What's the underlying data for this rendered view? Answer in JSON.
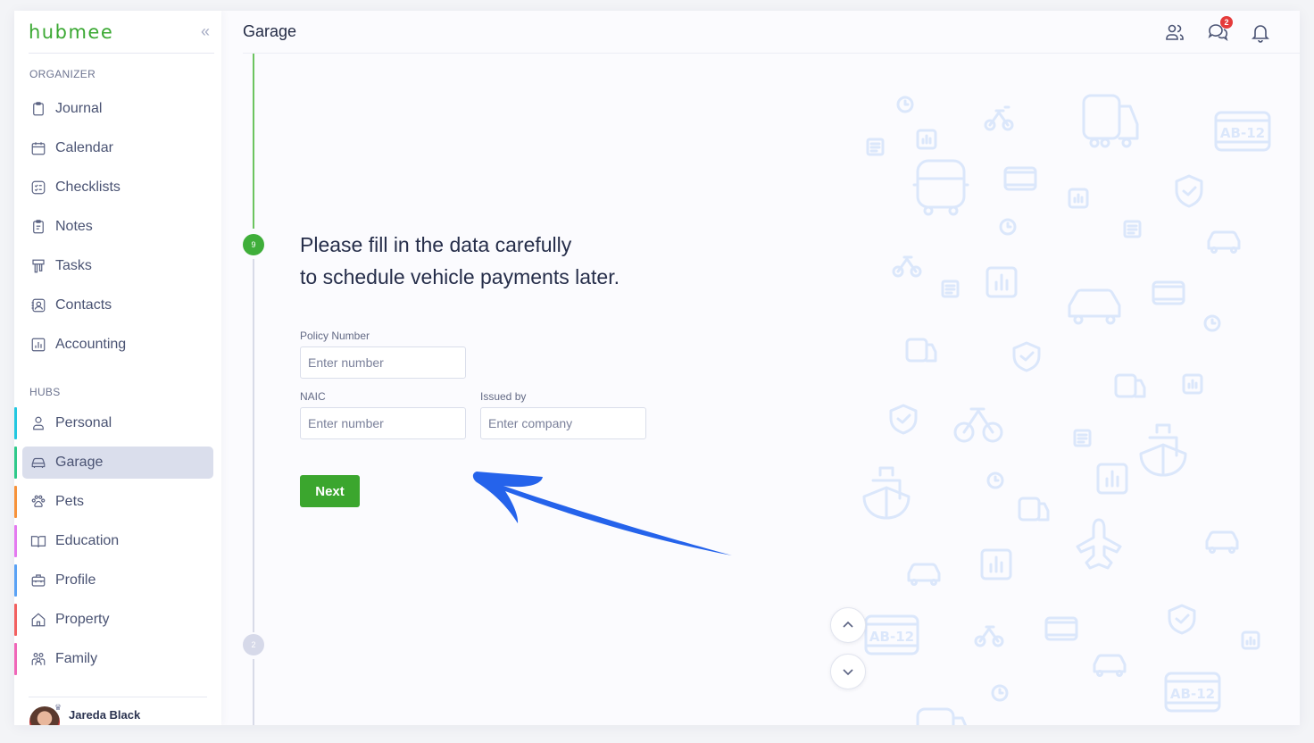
{
  "app": {
    "logo": "hubmee",
    "collapse_icon": "double-chevron-left"
  },
  "sidebar": {
    "organizer_label": "ORGANIZER",
    "organizer_items": [
      {
        "label": "Journal",
        "icon": "clipboard-icon"
      },
      {
        "label": "Calendar",
        "icon": "calendar-icon"
      },
      {
        "label": "Checklists",
        "icon": "checklist-icon"
      },
      {
        "label": "Notes",
        "icon": "notes-icon"
      },
      {
        "label": "Tasks",
        "icon": "tasks-icon"
      },
      {
        "label": "Contacts",
        "icon": "contacts-icon"
      },
      {
        "label": "Accounting",
        "icon": "chart-icon"
      }
    ],
    "hubs_label": "HUBS",
    "hub_items": [
      {
        "label": "Personal",
        "icon": "person-icon",
        "color": "#22c7e0"
      },
      {
        "label": "Garage",
        "icon": "car-icon",
        "color": "#2ec98a",
        "active": true
      },
      {
        "label": "Pets",
        "icon": "paw-icon",
        "color": "#f7923a"
      },
      {
        "label": "Education",
        "icon": "book-icon",
        "color": "#e479f0"
      },
      {
        "label": "Profile",
        "icon": "briefcase-icon",
        "color": "#5aa2f5"
      },
      {
        "label": "Property",
        "icon": "home-icon",
        "color": "#f26060"
      },
      {
        "label": "Family",
        "icon": "family-icon",
        "color": "#f066b8"
      }
    ],
    "user": {
      "name": "Jareda Black"
    }
  },
  "header": {
    "title": "Garage",
    "messages_badge": "2"
  },
  "form": {
    "current_step": "9",
    "next_step": "2",
    "headline_line1": "Please fill in the data carefully",
    "headline_line2": "to schedule vehicle payments later.",
    "policy_number_label": "Policy Number",
    "policy_number_placeholder": "Enter number",
    "naic_label": "NAIC",
    "naic_placeholder": "Enter number",
    "issued_by_label": "Issued by",
    "issued_by_placeholder": "Enter company",
    "next_label": "Next"
  },
  "colors": {
    "brand_green": "#3aa832",
    "button_green": "#3ba62e",
    "arrow_blue": "#2563eb",
    "badge_red": "#e53b3b"
  }
}
